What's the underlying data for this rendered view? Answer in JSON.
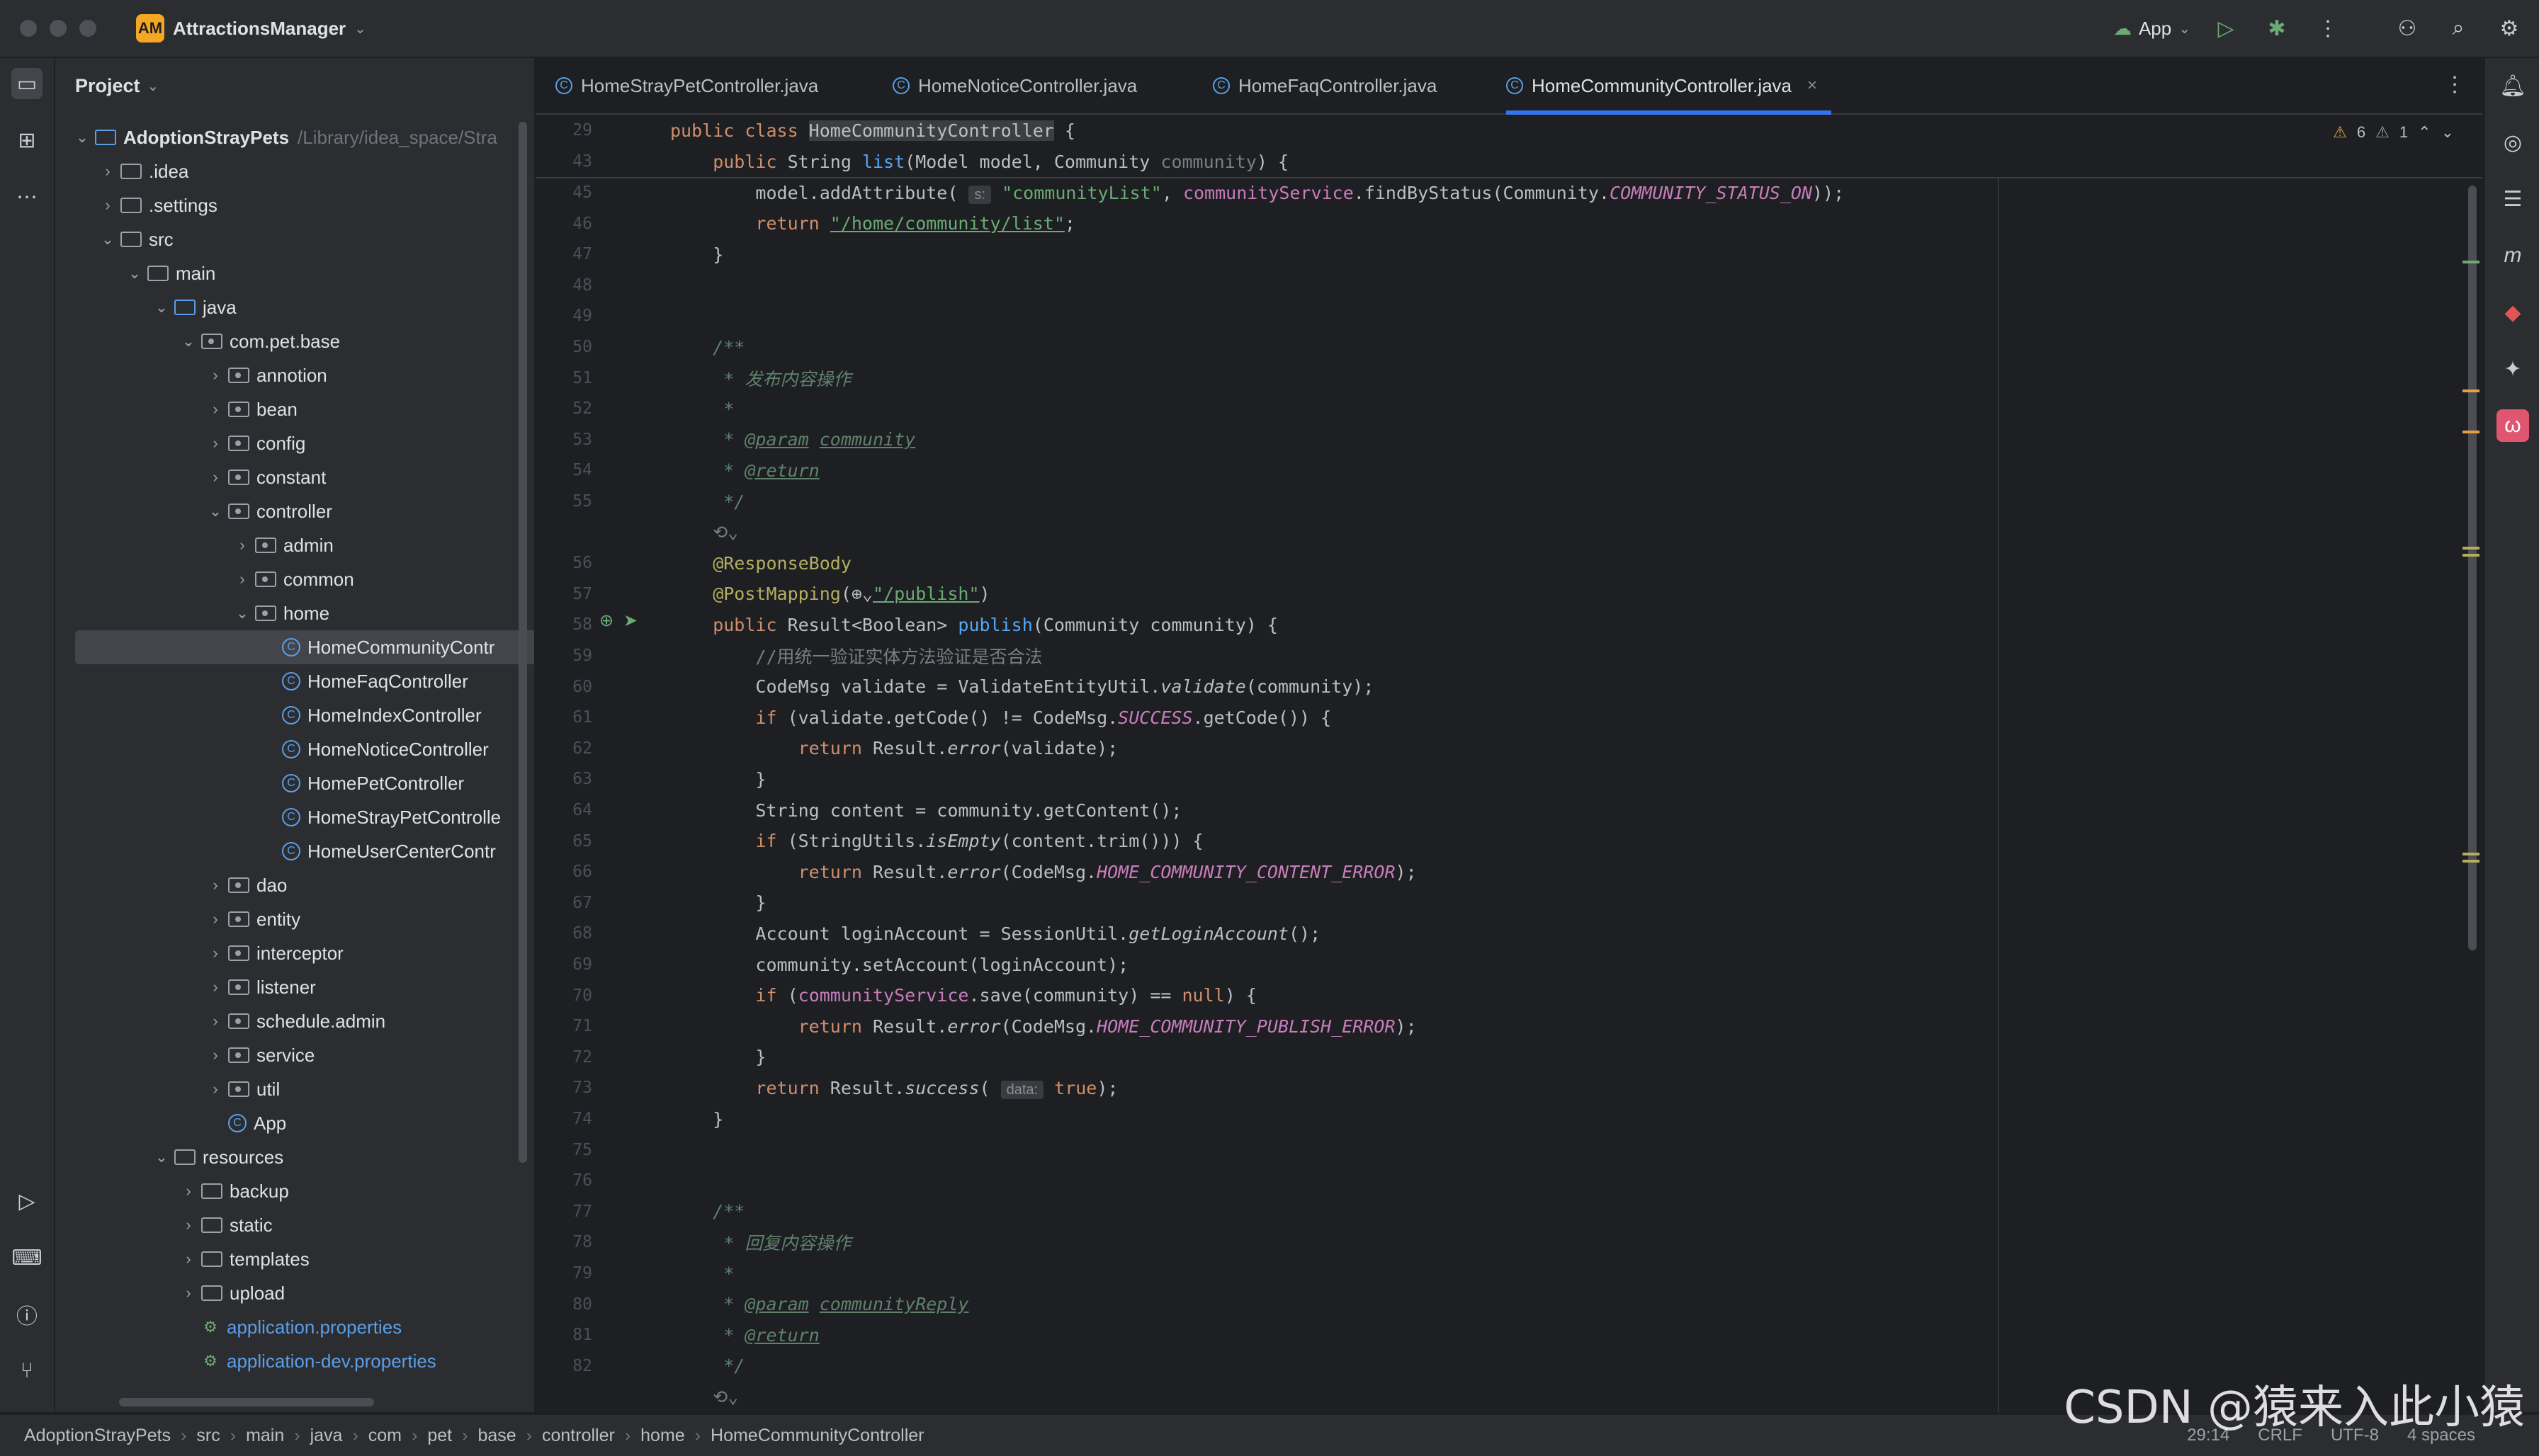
{
  "titlebar": {
    "project_badge": "AM",
    "project_name": "AttractionsManager",
    "run_config": "App"
  },
  "project_panel": {
    "title": "Project",
    "tree": [
      {
        "label": "AdoptionStrayPets",
        "path": "/Library/idea_space/Stra",
        "bold": true
      },
      {
        "label": ".idea"
      },
      {
        "label": ".settings"
      },
      {
        "label": "src"
      },
      {
        "label": "main"
      },
      {
        "label": "java"
      },
      {
        "label": "com.pet.base"
      },
      {
        "label": "annotion"
      },
      {
        "label": "bean"
      },
      {
        "label": "config"
      },
      {
        "label": "constant"
      },
      {
        "label": "controller"
      },
      {
        "label": "admin"
      },
      {
        "label": "common"
      },
      {
        "label": "home"
      },
      {
        "label": "HomeCommunityContr"
      },
      {
        "label": "HomeFaqController"
      },
      {
        "label": "HomeIndexController"
      },
      {
        "label": "HomeNoticeController"
      },
      {
        "label": "HomePetController"
      },
      {
        "label": "HomeStrayPetControlle"
      },
      {
        "label": "HomeUserCenterContr"
      },
      {
        "label": "dao"
      },
      {
        "label": "entity"
      },
      {
        "label": "interceptor"
      },
      {
        "label": "listener"
      },
      {
        "label": "schedule.admin"
      },
      {
        "label": "service"
      },
      {
        "label": "util"
      },
      {
        "label": "App"
      },
      {
        "label": "resources"
      },
      {
        "label": "backup"
      },
      {
        "label": "static"
      },
      {
        "label": "templates"
      },
      {
        "label": "upload"
      },
      {
        "label": "application.properties"
      },
      {
        "label": "application-dev.properties"
      }
    ]
  },
  "tabs": [
    {
      "label": "HomeStrayPetController.java"
    },
    {
      "label": "HomeNoticeController.java"
    },
    {
      "label": "HomeFaqController.java"
    },
    {
      "label": "HomeCommunityController.java",
      "active": true
    }
  ],
  "inspections": {
    "warnings": "6",
    "weak_warnings": "1"
  },
  "sticky": [
    {
      "ln": "29",
      "tokens": [
        [
          "kw",
          "public class "
        ],
        [
          "hlc",
          "HomeCommunityController"
        ],
        [
          "",
          " {"
        ]
      ]
    },
    {
      "ln": "43",
      "tokens": [
        [
          "kw",
          "    public "
        ],
        [
          "",
          "String "
        ],
        [
          "fn",
          "list"
        ],
        [
          "",
          "(Model model, Community "
        ],
        [
          "cm",
          "community"
        ],
        [
          "",
          ") {"
        ]
      ]
    }
  ],
  "lines": [
    {
      "ln": "45",
      "tokens": [
        [
          "",
          "        model.addAttribute( "
        ],
        [
          "hint",
          "s:"
        ],
        [
          "",
          " "
        ],
        [
          "str",
          "\"communityList\""
        ],
        [
          "",
          ", "
        ],
        [
          "fld",
          "communityService"
        ],
        [
          "",
          ".findByStatus(Community."
        ],
        [
          "stat",
          "COMMUNITY_STATUS_ON"
        ],
        [
          "",
          "));"
        ]
      ]
    },
    {
      "ln": "46",
      "tokens": [
        [
          "kw",
          "        return "
        ],
        [
          "strlink",
          "\"/home/community/list\""
        ],
        [
          "",
          ";"
        ]
      ]
    },
    {
      "ln": "47",
      "tokens": [
        [
          "",
          "    }"
        ]
      ]
    },
    {
      "ln": "48",
      "tokens": []
    },
    {
      "ln": "49",
      "tokens": []
    },
    {
      "ln": "50",
      "tokens": [
        [
          "jd",
          "    /**"
        ]
      ]
    },
    {
      "ln": "51",
      "tokens": [
        [
          "jd",
          "     * 发布内容操作"
        ]
      ]
    },
    {
      "ln": "52",
      "tokens": [
        [
          "jd",
          "     *"
        ]
      ]
    },
    {
      "ln": "53",
      "tokens": [
        [
          "jd",
          "     * "
        ],
        [
          "jdtag",
          "@param"
        ],
        [
          "jd",
          " "
        ],
        [
          "jdparam",
          "community"
        ]
      ]
    },
    {
      "ln": "54",
      "tokens": [
        [
          "jd",
          "     * "
        ],
        [
          "jdtag",
          "@return"
        ]
      ]
    },
    {
      "ln": "55",
      "tokens": [
        [
          "jd",
          "     */"
        ]
      ]
    },
    {
      "ln": "",
      "tokens": [
        [
          "cm",
          "    ⟲⌄"
        ]
      ]
    },
    {
      "ln": "56",
      "tokens": [
        [
          "an",
          "    @ResponseBody"
        ]
      ]
    },
    {
      "ln": "57",
      "tokens": [
        [
          "an",
          "    @PostMapping"
        ],
        [
          "",
          "(⊕⌄"
        ],
        [
          "strlink",
          "\"/publish\""
        ],
        [
          "",
          ")"
        ]
      ]
    },
    {
      "ln": "58",
      "tokens": [
        [
          "kw",
          "    public "
        ],
        [
          "",
          "Result<Boolean> "
        ],
        [
          "fn",
          "publish"
        ],
        [
          "",
          "(Community community) {"
        ]
      ]
    },
    {
      "ln": "59",
      "tokens": [
        [
          "cm",
          "        //用统一验证实体方法验证是否合法"
        ]
      ]
    },
    {
      "ln": "60",
      "tokens": [
        [
          "",
          "        CodeMsg validate = ValidateEntityUtil."
        ],
        [
          "ital",
          "validate"
        ],
        [
          "",
          "(community);"
        ]
      ]
    },
    {
      "ln": "61",
      "tokens": [
        [
          "kw",
          "        if "
        ],
        [
          "",
          "(validate.getCode() != CodeMsg."
        ],
        [
          "stat",
          "SUCCESS"
        ],
        [
          "",
          ".getCode()) {"
        ]
      ]
    },
    {
      "ln": "62",
      "tokens": [
        [
          "kw",
          "            return "
        ],
        [
          "",
          "Result."
        ],
        [
          "ital",
          "error"
        ],
        [
          "",
          "(validate);"
        ]
      ]
    },
    {
      "ln": "63",
      "tokens": [
        [
          "",
          "        }"
        ]
      ]
    },
    {
      "ln": "64",
      "tokens": [
        [
          "",
          "        String content = community.getContent();"
        ]
      ]
    },
    {
      "ln": "65",
      "tokens": [
        [
          "kw",
          "        if "
        ],
        [
          "",
          "(StringUtils."
        ],
        [
          "ital",
          "isEmpty"
        ],
        [
          "",
          "(content.trim())) {"
        ]
      ]
    },
    {
      "ln": "66",
      "tokens": [
        [
          "kw",
          "            return "
        ],
        [
          "",
          "Result."
        ],
        [
          "ital",
          "error"
        ],
        [
          "",
          "(CodeMsg."
        ],
        [
          "stat",
          "HOME_COMMUNITY_CONTENT_ERROR"
        ],
        [
          "",
          ");"
        ]
      ]
    },
    {
      "ln": "67",
      "tokens": [
        [
          "",
          "        }"
        ]
      ]
    },
    {
      "ln": "68",
      "tokens": [
        [
          "",
          "        Account loginAccount = SessionUtil."
        ],
        [
          "ital",
          "getLoginAccount"
        ],
        [
          "",
          "();"
        ]
      ]
    },
    {
      "ln": "69",
      "tokens": [
        [
          "",
          "        community.setAccount(loginAccount);"
        ]
      ]
    },
    {
      "ln": "70",
      "tokens": [
        [
          "kw",
          "        if "
        ],
        [
          "",
          "("
        ],
        [
          "fld",
          "communityService"
        ],
        [
          "",
          ".save(community) == "
        ],
        [
          "kw",
          "null"
        ],
        [
          "",
          ") {"
        ]
      ]
    },
    {
      "ln": "71",
      "tokens": [
        [
          "kw",
          "            return "
        ],
        [
          "",
          "Result."
        ],
        [
          "ital",
          "error"
        ],
        [
          "",
          "(CodeMsg."
        ],
        [
          "stat",
          "HOME_COMMUNITY_PUBLISH_ERROR"
        ],
        [
          "",
          ");"
        ]
      ]
    },
    {
      "ln": "72",
      "tokens": [
        [
          "",
          "        }"
        ]
      ]
    },
    {
      "ln": "73",
      "tokens": [
        [
          "kw",
          "        return "
        ],
        [
          "",
          "Result."
        ],
        [
          "ital",
          "success"
        ],
        [
          "",
          "( "
        ],
        [
          "hint",
          "data:"
        ],
        [
          "",
          " "
        ],
        [
          "kw",
          "true"
        ],
        [
          "",
          ");"
        ]
      ]
    },
    {
      "ln": "74",
      "tokens": [
        [
          "",
          "    }"
        ]
      ]
    },
    {
      "ln": "75",
      "tokens": []
    },
    {
      "ln": "76",
      "tokens": []
    },
    {
      "ln": "77",
      "tokens": [
        [
          "jd",
          "    /**"
        ]
      ]
    },
    {
      "ln": "78",
      "tokens": [
        [
          "jd",
          "     * 回复内容操作"
        ]
      ]
    },
    {
      "ln": "79",
      "tokens": [
        [
          "jd",
          "     *"
        ]
      ]
    },
    {
      "ln": "80",
      "tokens": [
        [
          "jd",
          "     * "
        ],
        [
          "jdtag",
          "@param"
        ],
        [
          "jd",
          " "
        ],
        [
          "jdparam",
          "communityReply"
        ]
      ]
    },
    {
      "ln": "81",
      "tokens": [
        [
          "jd",
          "     * "
        ],
        [
          "jdtag",
          "@return"
        ]
      ]
    },
    {
      "ln": "82",
      "tokens": [
        [
          "jd",
          "     */"
        ]
      ]
    },
    {
      "ln": "",
      "tokens": [
        [
          "cm",
          "    ⟲⌄"
        ]
      ]
    }
  ],
  "breadcrumbs": [
    "AdoptionStrayPets",
    "src",
    "main",
    "java",
    "com",
    "pet",
    "base",
    "controller",
    "home",
    "HomeCommunityController"
  ],
  "status": {
    "position": "29:14",
    "line_sep": "CRLF",
    "encoding": "UTF-8",
    "indent": "4 spaces"
  },
  "watermark": "CSDN @猿来入此小猿"
}
